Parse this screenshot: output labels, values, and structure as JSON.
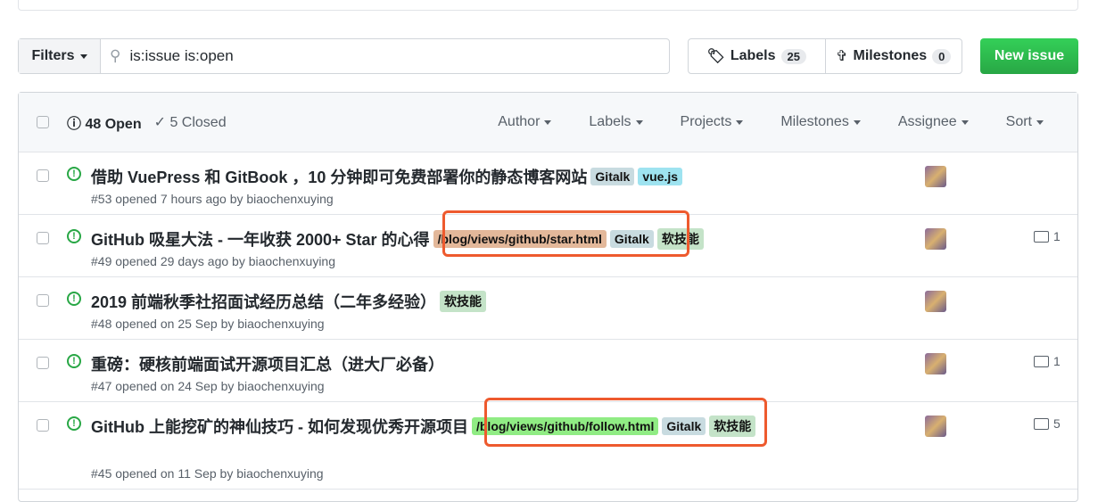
{
  "search": {
    "filters_label": "Filters",
    "query": "is:issue is:open"
  },
  "labels": {
    "label": "Labels",
    "count": "25"
  },
  "milestones": {
    "label": "Milestones",
    "count": "0"
  },
  "new_issue": "New issue",
  "header": {
    "open": "48 Open",
    "closed": "5 Closed",
    "filters": [
      "Author",
      "Labels",
      "Projects",
      "Milestones",
      "Assignee",
      "Sort"
    ]
  },
  "issues": [
    {
      "title": "借助 VuePress 和 GitBook ，10 分钟即可免费部署你的静态博客网站",
      "labels": [
        {
          "name": "Gitalk",
          "color": "#c8dbe0"
        },
        {
          "name": "vue.js",
          "color": "#9ee3f0"
        }
      ],
      "meta": "#53 opened 7 hours ago by biaochenxuying",
      "comments": ""
    },
    {
      "title": "GitHub 吸星大法 - 一年收获 2000+ Star 的心得",
      "labels": [
        {
          "name": "/blog/views/github/star.html",
          "color": "#e3b89a"
        },
        {
          "name": "Gitalk",
          "color": "#c8dbe0"
        },
        {
          "name": "软技能",
          "color": "#c4e3c8"
        }
      ],
      "meta": "#49 opened 29 days ago by biaochenxuying",
      "comments": "1"
    },
    {
      "title": "2019 前端秋季社招面试经历总结（二年多经验）",
      "labels": [
        {
          "name": "软技能",
          "color": "#c4e3c8"
        }
      ],
      "meta": "#48 opened on 25 Sep by biaochenxuying",
      "comments": ""
    },
    {
      "title": "重磅：硬核前端面试开源项目汇总（进大厂必备）",
      "labels": [],
      "meta": "#47 opened on 24 Sep by biaochenxuying",
      "comments": "1"
    },
    {
      "title": "GitHub 上能挖矿的神仙技巧 - 如何发现优秀开源项目",
      "labels": [
        {
          "name": "/blog/views/github/follow.html",
          "color": "#90ec84"
        },
        {
          "name": "Gitalk",
          "color": "#c8dbe0"
        },
        {
          "name": "软技能",
          "color": "#c4e3c8"
        }
      ],
      "meta": "#45 opened on 11 Sep by biaochenxuying",
      "comments": "5"
    }
  ]
}
